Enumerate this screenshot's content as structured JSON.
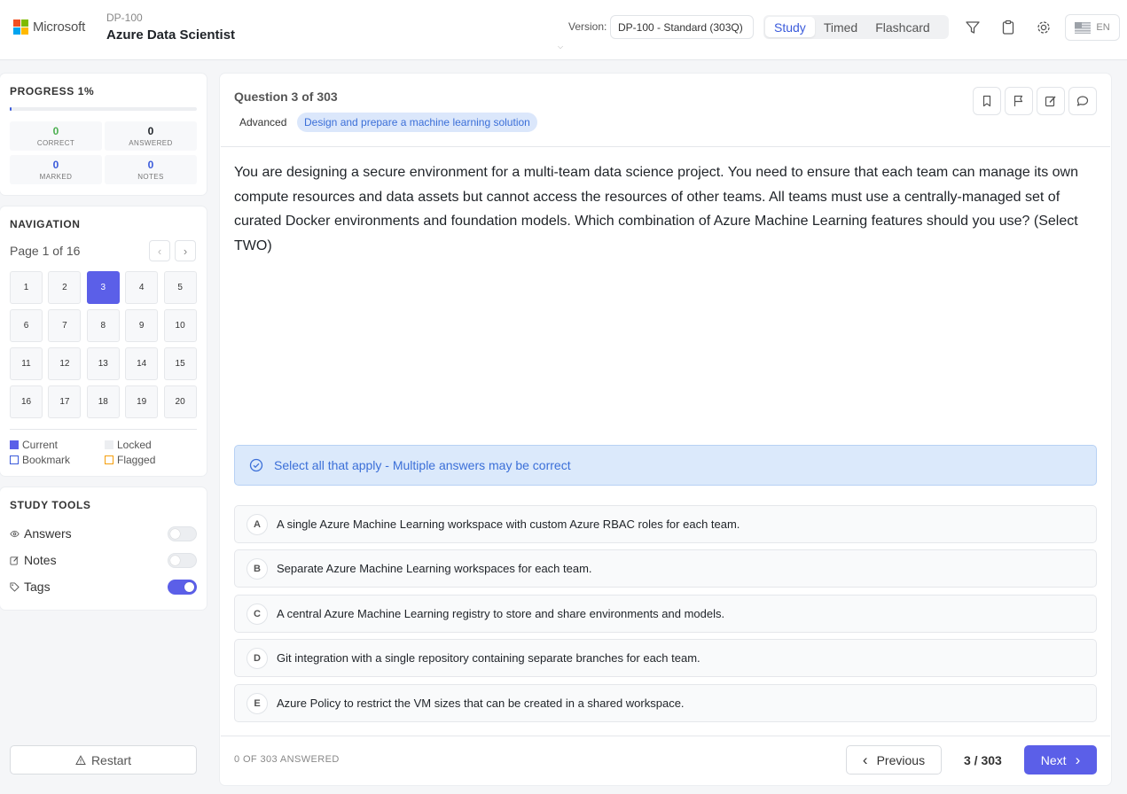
{
  "brand": {
    "name": "Microsoft",
    "logo_colors": [
      "#f25022",
      "#7fba00",
      "#00a4ef",
      "#ffb900"
    ],
    "logo_icon": "microsoft-logo-icon"
  },
  "exam": {
    "code": "DP-100",
    "title": "Azure Data Scientist"
  },
  "version": {
    "label": "Version:",
    "selected": "DP-100 - Standard (303Q)"
  },
  "modes": [
    "Study",
    "Timed",
    "Flashcard"
  ],
  "active_mode": "Study",
  "header_icons": [
    "filter-icon",
    "clipboard-icon",
    "gear-icon"
  ],
  "language": {
    "code": "EN",
    "icon": "us-flag-icon"
  },
  "progress": {
    "title": "PROGRESS 1%",
    "percent": 1,
    "stats": [
      {
        "value": "0",
        "label": "CORRECT",
        "color": "#4caf50"
      },
      {
        "value": "0",
        "label": "ANSWERED",
        "color": "#1f2328"
      },
      {
        "value": "0",
        "label": "MARKED",
        "color": "#3b5bdb"
      },
      {
        "value": "0",
        "label": "NOTES",
        "color": "#3b5bdb"
      }
    ]
  },
  "navigation": {
    "title": "NAVIGATION",
    "page_label": "Page 1 of 16",
    "prev_icon": "chevron-left-icon",
    "next_icon": "chevron-right-icon",
    "cells": [
      "1",
      "2",
      "3",
      "4",
      "5",
      "6",
      "7",
      "8",
      "9",
      "10",
      "11",
      "12",
      "13",
      "14",
      "15",
      "16",
      "17",
      "18",
      "19",
      "20"
    ],
    "current": "3",
    "legend": [
      {
        "label": "Current",
        "swatch": "#5b5fe8"
      },
      {
        "label": "Locked",
        "swatch": "#eceef1"
      },
      {
        "label": "Bookmark",
        "swatch": "#3b5bdb"
      },
      {
        "label": "Flagged",
        "swatch": "#f59e0b"
      }
    ]
  },
  "study_tools": {
    "title": "STUDY TOOLS",
    "items": [
      {
        "label": "Answers",
        "icon": "eye-icon",
        "enabled": false
      },
      {
        "label": "Notes",
        "icon": "edit-icon",
        "enabled": false
      },
      {
        "label": "Tags",
        "icon": "tag-icon",
        "enabled": true
      }
    ]
  },
  "restart": {
    "label": "Restart",
    "icon": "warning-icon"
  },
  "question": {
    "heading": "Question 3 of 303",
    "level": "Advanced",
    "tag": "Design and prepare a machine learning solution",
    "action_icons": [
      "bookmark-icon",
      "flag-icon",
      "edit-icon",
      "comment-icon"
    ],
    "text": "You are designing a secure environment for a multi-team data science project. You need to ensure that each team can manage its own compute resources and data assets but cannot access the resources of other teams. All teams must use a centrally-managed set of curated Docker environments and foundation models. Which combination of Azure Machine Learning features should you use? (Select TWO)",
    "hint": "Select all that apply - Multiple answers may be correct",
    "hint_icon": "check-circle-icon",
    "options": [
      {
        "letter": "A",
        "text": "A single Azure Machine Learning workspace with custom Azure RBAC roles for each team."
      },
      {
        "letter": "B",
        "text": "Separate Azure Machine Learning workspaces for each team."
      },
      {
        "letter": "C",
        "text": "A central Azure Machine Learning registry to store and share environments and models."
      },
      {
        "letter": "D",
        "text": "Git integration with a single repository containing separate branches for each team."
      },
      {
        "letter": "E",
        "text": "Azure Policy to restrict the VM sizes that can be created in a shared workspace."
      }
    ]
  },
  "footer": {
    "answered": "0 OF 303 ANSWERED",
    "previous": "Previous",
    "counter": "3 / 303",
    "next": "Next"
  }
}
